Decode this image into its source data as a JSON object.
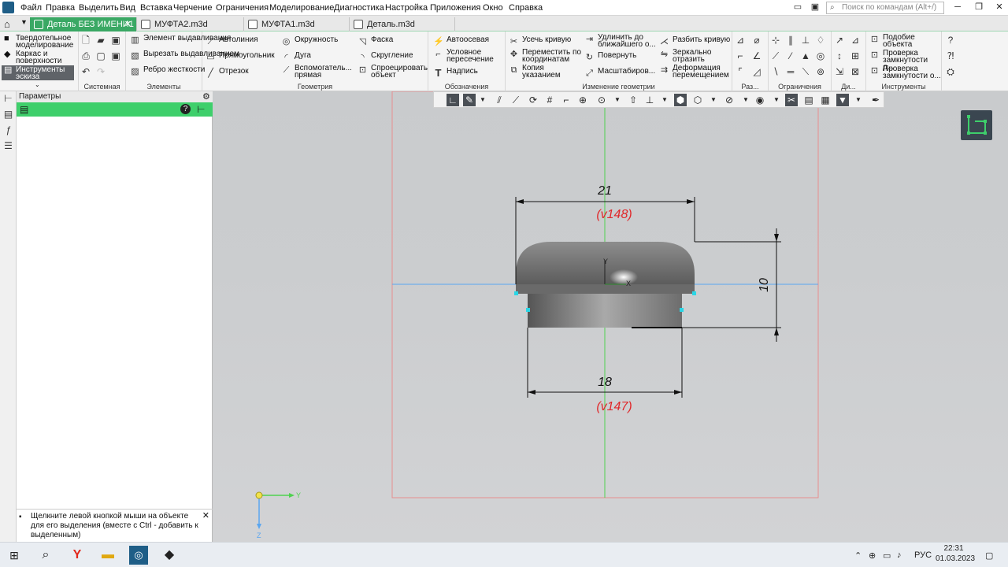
{
  "app": {
    "menu": [
      "Файл",
      "Правка",
      "Выделить",
      "Вид",
      "Вставка",
      "Черчение",
      "Ограничения",
      "Моделирование",
      "Диагностика",
      "Настройка",
      "Приложения",
      "Окно",
      "Справка"
    ],
    "search_placeholder": "Поиск по командам (Alt+/)"
  },
  "tabs": [
    {
      "label": "Деталь БЕЗ ИМЕНИ1",
      "active": true
    },
    {
      "label": "МУФТА2.m3d"
    },
    {
      "label": "МУФТА1.m3d"
    },
    {
      "label": "Деталь.m3d"
    }
  ],
  "ribbon": {
    "modes": [
      "Твердотельное моделирование",
      "Каркас и поверхности",
      "Инструменты эскиза"
    ],
    "groups": {
      "system": "Системная",
      "elements": "Элементы",
      "geometry": "Геометрия",
      "designations": "Обозначения",
      "geom_change": "Изменение геометрии",
      "raz": "Раз...",
      "constraints": "Ограничения",
      "di": "Ди...",
      "tools": "Инструменты"
    },
    "elements": [
      "Элемент выдавливания",
      "Вырезать выдавливанием",
      "Ребро жесткости"
    ],
    "geometry": [
      "Автолиния",
      "Прямоугольник",
      "Отрезок",
      "Окружность",
      "Дуга",
      "Вспомогатель... прямая",
      "Фаска",
      "Скругление",
      "Спроецировать объект"
    ],
    "designations": [
      "Автоосевая",
      "Условное пересечение",
      "Надпись"
    ],
    "geom_change": [
      "Усечь кривую",
      "Переместить по координатам",
      "Копия указанием",
      "Удлинить до ближайшего о...",
      "Повернуть",
      "Масштабиров...",
      "Разбить кривую",
      "Зеркально отразить",
      "Деформация перемещением"
    ],
    "tools": [
      "Подобие объекта",
      "Проверка замкнутости д...",
      "Проверка замкнутости о..."
    ]
  },
  "panel": {
    "title": "Параметры",
    "hint": "Щелкните левой кнопкой мыши на объекте для его выделения (вместе с Ctrl - добавить к выделенным)"
  },
  "drawing": {
    "dim_top": "21",
    "var_top": "(v148)",
    "dim_bottom": "18",
    "var_bottom": "(v147)",
    "dim_right": "10",
    "axis_x": "X",
    "axis_y": "Y",
    "triad_y": "Y",
    "triad_z": "Z"
  },
  "taskbar": {
    "lang": "РУС",
    "time": "22:31",
    "date": "01.03.2023"
  },
  "colors": {
    "active_tab": "#3aa864",
    "panel_bar": "#3ecf6b",
    "dim_red": "#e0282a",
    "axis_green": "#4fd14f",
    "axis_blue": "#5aa6f0"
  }
}
